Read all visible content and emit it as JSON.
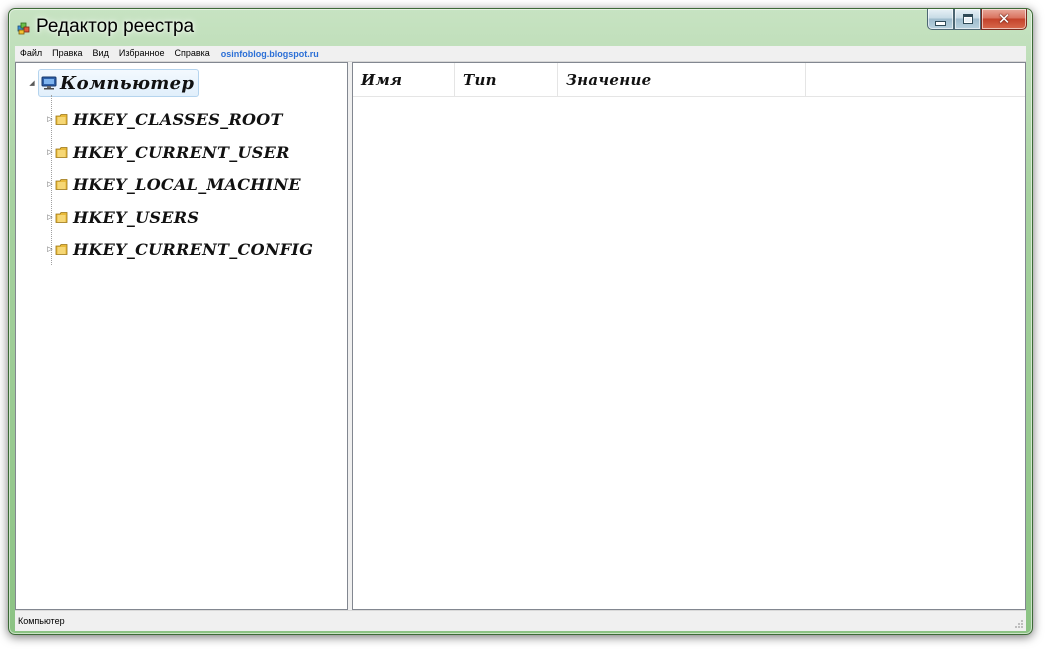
{
  "window": {
    "title": "Редактор реестра"
  },
  "menu": {
    "items": [
      "Файл",
      "Правка",
      "Вид",
      "Избранное",
      "Справка"
    ],
    "watermark": "osinfoblog.blogspot.ru"
  },
  "tree": {
    "root": "Компьютер",
    "keys": [
      "HKEY_CLASSES_ROOT",
      "HKEY_CURRENT_USER",
      "HKEY_LOCAL_MACHINE",
      "HKEY_USERS",
      "HKEY_CURRENT_CONFIG"
    ]
  },
  "list": {
    "columns": [
      "Имя",
      "Тип",
      "Значение"
    ]
  },
  "status": {
    "text": "Компьютер"
  },
  "icons": {
    "app": "registry-icon",
    "root": "computer-icon",
    "key": "folder-icon",
    "minimize": "minimize-icon",
    "maximize": "maximize-icon",
    "close": "close-icon"
  },
  "colors": {
    "frame": "#a7d2a0",
    "selection": "#e1effb",
    "watermark": "#2b6fd6",
    "close": "#c4432b"
  }
}
